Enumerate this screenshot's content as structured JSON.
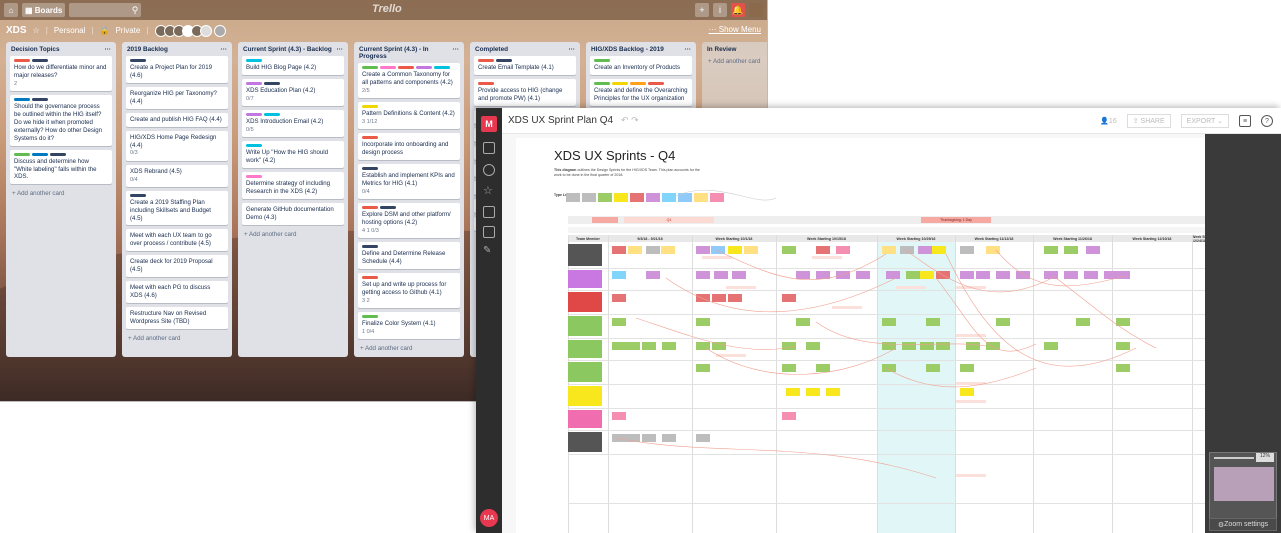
{
  "trello": {
    "top": {
      "boards_label": "Boards",
      "logo": "Trello"
    },
    "board": {
      "name": "XDS",
      "team": "Personal",
      "visibility": "Private",
      "show_menu": "Show Menu"
    },
    "add_card": "+ Add another card",
    "lists": [
      {
        "title": "Decision Topics",
        "cards": [
          {
            "text": "How do we differentiate minor and major releases?",
            "labels": [
              "#eb5a46",
              "#344563"
            ],
            "badges": "2"
          },
          {
            "text": "Should the governance process be outlined within the HIG itself? Do we hide it when promoted externally? How do other Design Systems do it?",
            "labels": [
              "#0079bf",
              "#344563"
            ],
            "badges": ""
          },
          {
            "text": "Discuss and determine how \"White labeling\" falls within the XDS.",
            "labels": [
              "#61bd4f",
              "#0079bf",
              "#344563"
            ],
            "badges": ""
          }
        ]
      },
      {
        "title": "2019 Backlog",
        "cards": [
          {
            "text": "Create a Project Plan for 2019 (4.6)",
            "labels": [
              "#344563"
            ],
            "badges": ""
          },
          {
            "text": "Reorganize HIG per Taxonomy? (4.4)",
            "labels": [],
            "badges": ""
          },
          {
            "text": "Create and publish HIG FAQ (4.4)",
            "labels": [],
            "badges": ""
          },
          {
            "text": "HIG/XDS Home Page Redesign (4.4)",
            "labels": [],
            "badges": "0/3"
          },
          {
            "text": "XDS Rebrand (4.5)",
            "labels": [],
            "badges": "0/4"
          },
          {
            "text": "Create a 2019 Staffing Plan including Skillsets and Budget (4.5)",
            "labels": [
              "#344563"
            ],
            "badges": ""
          },
          {
            "text": "Meet with each UX team to go over process / contribute (4.5)",
            "labels": [],
            "badges": ""
          },
          {
            "text": "Create deck for 2019 Proposal (4.5)",
            "labels": [],
            "badges": ""
          },
          {
            "text": "Meet with each PG to discuss XDS (4.6)",
            "labels": [],
            "badges": ""
          },
          {
            "text": "Restructure Nav on Revised Wordpress Site (TBD)",
            "labels": [],
            "badges": ""
          }
        ]
      },
      {
        "title": "Current Sprint (4.3) - Backlog",
        "cards": [
          {
            "text": "Build HIG Blog Page (4.2)",
            "labels": [
              "#00c2e0"
            ],
            "badges": ""
          },
          {
            "text": "XDS Education Plan (4.2)",
            "labels": [
              "#c377e0",
              "#344563"
            ],
            "badges": "0/7"
          },
          {
            "text": "XDS Introduction Email (4.2)",
            "labels": [
              "#c377e0",
              "#00c2e0"
            ],
            "badges": "0/5"
          },
          {
            "text": "Write Up \"How the HIG should work\" (4.2)",
            "labels": [
              "#00c2e0"
            ],
            "badges": ""
          },
          {
            "text": "Determine strategy of including Research in the XDS (4.2)",
            "labels": [
              "#ff78cb"
            ],
            "badges": ""
          },
          {
            "text": "Generate GitHub documentation Demo (4.3)",
            "labels": [],
            "badges": ""
          }
        ]
      },
      {
        "title": "Current Sprint (4.3) - In Progress",
        "cards": [
          {
            "text": "Create a Common Taxonomy for all patterns and components (4.2)",
            "labels": [
              "#61bd4f",
              "#ff78cb",
              "#eb5a46",
              "#c377e0",
              "#00c2e0"
            ],
            "badges": "2/5"
          },
          {
            "text": "Pattern Definitions & Content (4.2)",
            "labels": [
              "#f2d600"
            ],
            "badges": "3  1/12"
          },
          {
            "text": "Incorporate into onboarding and design process",
            "labels": [
              "#eb5a46"
            ],
            "badges": ""
          },
          {
            "text": "Establish and implement KPIs and Metrics for HIG (4.1)",
            "labels": [
              "#344563"
            ],
            "badges": "0/4"
          },
          {
            "text": "Explore DSM and other platform/ hosting options (4.2)",
            "labels": [
              "#eb5a46",
              "#344563"
            ],
            "badges": "4  1  0/3"
          },
          {
            "text": "Define and Determine Release Schedule (4.4)",
            "labels": [
              "#344563"
            ],
            "badges": ""
          },
          {
            "text": "Set up and write up process for getting access to Github (4.1)",
            "labels": [
              "#eb5a46"
            ],
            "badges": "3  2"
          },
          {
            "text": "Finalize Color System (4.1)",
            "labels": [
              "#61bd4f"
            ],
            "badges": "1  0/4"
          }
        ]
      },
      {
        "title": "Completed",
        "cards": [
          {
            "text": "Create Email Template (4.1)",
            "labels": [
              "#eb5a46",
              "#344563"
            ],
            "badges": ""
          },
          {
            "text": "Provide access to HIG (change and promote PW) (4.1)",
            "labels": [
              "#eb5a46"
            ],
            "badges": ""
          },
          {
            "text": "Editor",
            "labels": [],
            "badges": ""
          },
          {
            "text": "Comm",
            "labels": [],
            "badges": ""
          },
          {
            "text": "Create UX&D",
            "labels": [],
            "badges": ""
          },
          {
            "text": "Gover",
            "labels": [],
            "badges": ""
          },
          {
            "text": "Updat",
            "labels": [],
            "badges": ""
          },
          {
            "text": "XDS L",
            "labels": [],
            "badges": ""
          },
          {
            "text": "Updat",
            "labels": [],
            "badges": ""
          }
        ]
      },
      {
        "title": "HIG/XDS Backlog - 2019",
        "cards": [
          {
            "text": "Create an Inventory of Products",
            "labels": [
              "#61bd4f"
            ],
            "badges": ""
          },
          {
            "text": "Create and define the Overarching Principles for the UX organization",
            "labels": [
              "#61bd4f",
              "#f2d600",
              "#ff9f1a",
              "#eb5a46"
            ],
            "badges": ""
          }
        ]
      },
      {
        "title": "In Review",
        "cards": []
      }
    ]
  },
  "lucid": {
    "logo": "M",
    "user_initials": "MA",
    "title": "XDS UX Sprint Plan Q4",
    "collaborators": "16",
    "share": "SHARE",
    "export": "EXPORT",
    "zoom_settings": "Zoom settings",
    "zoom_pct": "12%",
    "diagram": {
      "title": "XDS UX Sprints - Q4",
      "description_bold": "This diagram",
      "description": " outlines the Design Sprints for the HIG/XDS Team. This plan accounts for the work to be done in the final quarter of 2018.",
      "legend_label": "Type Legend",
      "legend": [
        {
          "color": "#bdbdbd"
        },
        {
          "color": "#bdbdbd"
        },
        {
          "color": "#9ccc65"
        },
        {
          "color": "#f8e71c"
        },
        {
          "color": "#e57373"
        },
        {
          "color": "#ce93d8"
        },
        {
          "color": "#81d4fa"
        },
        {
          "color": "#90caf9"
        },
        {
          "color": "#ffe082"
        },
        {
          "color": "#f48fb1"
        }
      ],
      "team_member_header": "Team Member",
      "q4_label": "Q4",
      "thanksgiving": "Thanksgiving: 1 Day",
      "week_headers": [
        "9/3/18 - 9/21/18",
        "Week Starting 10/1/18",
        "Week Starting 10/15/18",
        "Week Starting 10/29/18",
        "Week Starting 11/12/18",
        "Week Starting 11/26/18",
        "Week Starting 12/10/18",
        "Week Starting 12/24/18"
      ],
      "rows": [
        {
          "color": "#555555"
        },
        {
          "color": "#c878e0"
        },
        {
          "color": "#e04848"
        },
        {
          "color": "#8cc860"
        },
        {
          "color": "#8cc860"
        },
        {
          "color": "#8cc860"
        },
        {
          "color": "#f8e71c"
        },
        {
          "color": "#f06eb0"
        },
        {
          "color": "#555555"
        }
      ]
    }
  }
}
